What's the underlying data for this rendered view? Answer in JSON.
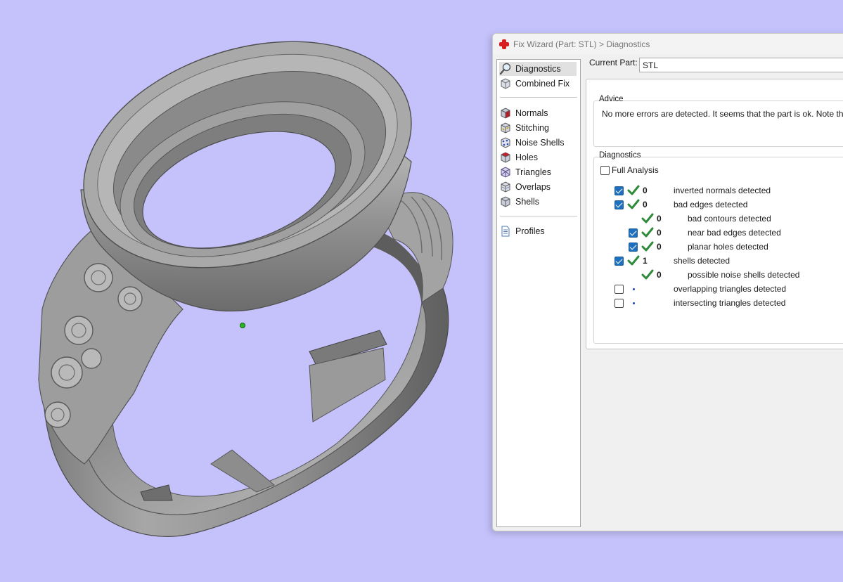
{
  "window": {
    "title": "Fix Wizard (Part: STL) > Diagnostics"
  },
  "nav": {
    "items": [
      {
        "label": "Diagnostics",
        "icon": "magnifier-icon",
        "selected": true
      },
      {
        "label": "Combined Fix",
        "icon": "cube-icon"
      },
      {
        "label": "Normals",
        "icon": "normals-cube-icon"
      },
      {
        "label": "Stitching",
        "icon": "stitching-cube-icon"
      },
      {
        "label": "Noise Shells",
        "icon": "noise-shells-icon"
      },
      {
        "label": "Holes",
        "icon": "holes-cube-icon"
      },
      {
        "label": "Triangles",
        "icon": "triangles-cube-icon"
      },
      {
        "label": "Overlaps",
        "icon": "overlaps-cube-icon"
      },
      {
        "label": "Shells",
        "icon": "shells-cube-icon"
      },
      {
        "label": "Profiles",
        "icon": "document-icon"
      }
    ]
  },
  "current_part": {
    "label": "Current Part:",
    "value": "STL"
  },
  "advice": {
    "title": "Advice",
    "text": "No more errors are detected. It seems that the part is ok. Note that no"
  },
  "diagnostics": {
    "title": "Diagnostics",
    "full_analysis": "Full Analysis",
    "rows": [
      {
        "checked": true,
        "status": "ok",
        "count": "0",
        "label": "inverted normals detected"
      },
      {
        "checked": true,
        "status": "ok",
        "count": "0",
        "label": "bad edges detected"
      },
      {
        "checked": null,
        "status": "ok",
        "count": "0",
        "label": "bad contours detected"
      },
      {
        "checked": true,
        "status": "ok",
        "count": "0",
        "label": "near bad edges detected"
      },
      {
        "checked": true,
        "status": "ok",
        "count": "0",
        "label": "planar holes detected"
      },
      {
        "checked": true,
        "status": "ok",
        "count": "1",
        "label": "shells detected"
      },
      {
        "checked": null,
        "status": "ok",
        "count": "0",
        "label": "possible noise shells detected"
      },
      {
        "checked": false,
        "status": "pending",
        "count": "",
        "label": "overlapping triangles detected"
      },
      {
        "checked": false,
        "status": "pending",
        "count": "",
        "label": "intersecting triangles detected"
      }
    ]
  },
  "colors": {
    "viewport_background": "#c5c2fb",
    "checkbox_checked": "#1f6fbd",
    "tick_green": "#2e8b3a",
    "pivot_marker": "#27b527"
  }
}
